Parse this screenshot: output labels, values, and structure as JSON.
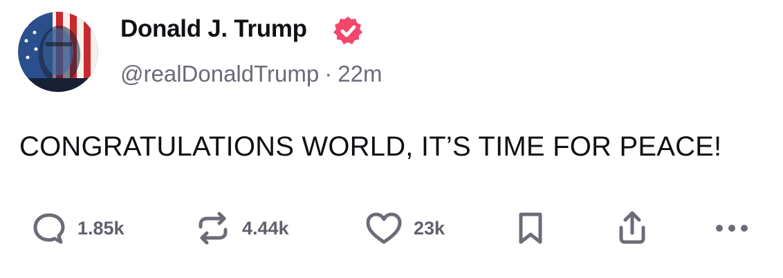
{
  "author": {
    "display_name": "Donald J. Trump",
    "handle": "@realDonaldTrump",
    "separator": "·",
    "time_ago": "22m",
    "verified_icon": "verified-badge-icon",
    "avatar": "avatar-american-flag-portrait"
  },
  "post": {
    "text": "CONGRATULATIONS WORLD, IT’S TIME FOR PEACE!"
  },
  "actions": {
    "reply": {
      "icon": "reply-bubble-icon",
      "count": "1.85k"
    },
    "repost": {
      "icon": "repost-arrows-icon",
      "count": "4.44k"
    },
    "like": {
      "icon": "heart-icon",
      "count": "23k"
    },
    "bookmark": {
      "icon": "bookmark-icon"
    },
    "share": {
      "icon": "share-icon"
    },
    "more": {
      "icon": "more-dots-icon"
    }
  },
  "colors": {
    "verified_badge": "#f2466a",
    "icon_gray": "#6c6c78",
    "text_primary": "#0f0f14",
    "text_secondary": "#6a6a78"
  }
}
